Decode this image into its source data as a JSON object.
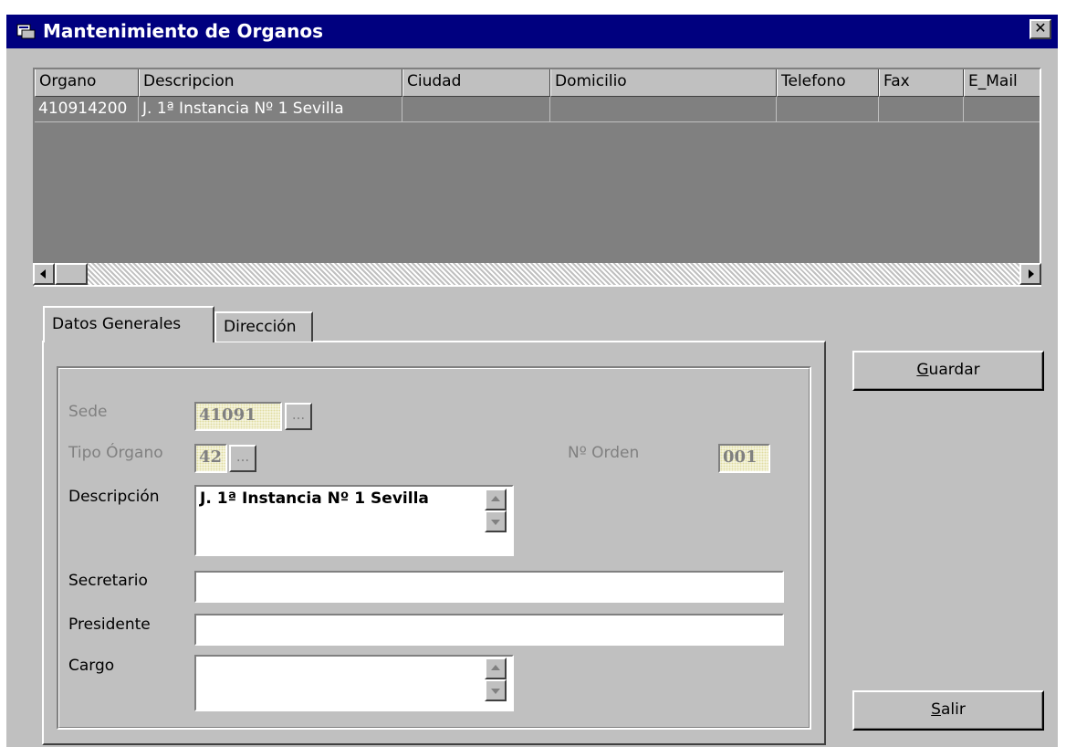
{
  "window": {
    "title": "Mantenimiento de Organos",
    "close_glyph": "✕"
  },
  "grid": {
    "headers": [
      "Organo",
      "Descripcion",
      "Ciudad",
      "Domicilio",
      "Telefono",
      "Fax",
      "E_Mail"
    ],
    "rows": [
      [
        "410914200",
        "J. 1ª Instancia  Nº 1 Sevilla",
        "",
        "",
        "",
        "",
        ""
      ]
    ]
  },
  "tabs": [
    {
      "label": "Datos Generales",
      "selected": true
    },
    {
      "label": "Dirección",
      "selected": false
    }
  ],
  "form": {
    "sede_label": "Sede",
    "sede_value": "41091",
    "tipo_label": "Tipo Órgano",
    "tipo_value": "42",
    "orden_label": "Nº Orden",
    "orden_value": "001",
    "descripcion_label": "Descripción",
    "descripcion_value": "J. 1ª Instancia  Nº 1 Sevilla",
    "secretario_label": "Secretario",
    "secretario_value": "",
    "presidente_label": "Presidente",
    "presidente_value": "",
    "cargo_label": "Cargo",
    "cargo_value": "",
    "browse_label": "..."
  },
  "buttons": {
    "guardar_accel": "G",
    "guardar_rest": "uardar",
    "salir_accel": "S",
    "salir_rest": "alir"
  },
  "colors": {
    "titlebar": "#00007f",
    "face": "#c0c0c0",
    "grid_bg": "#808080"
  }
}
